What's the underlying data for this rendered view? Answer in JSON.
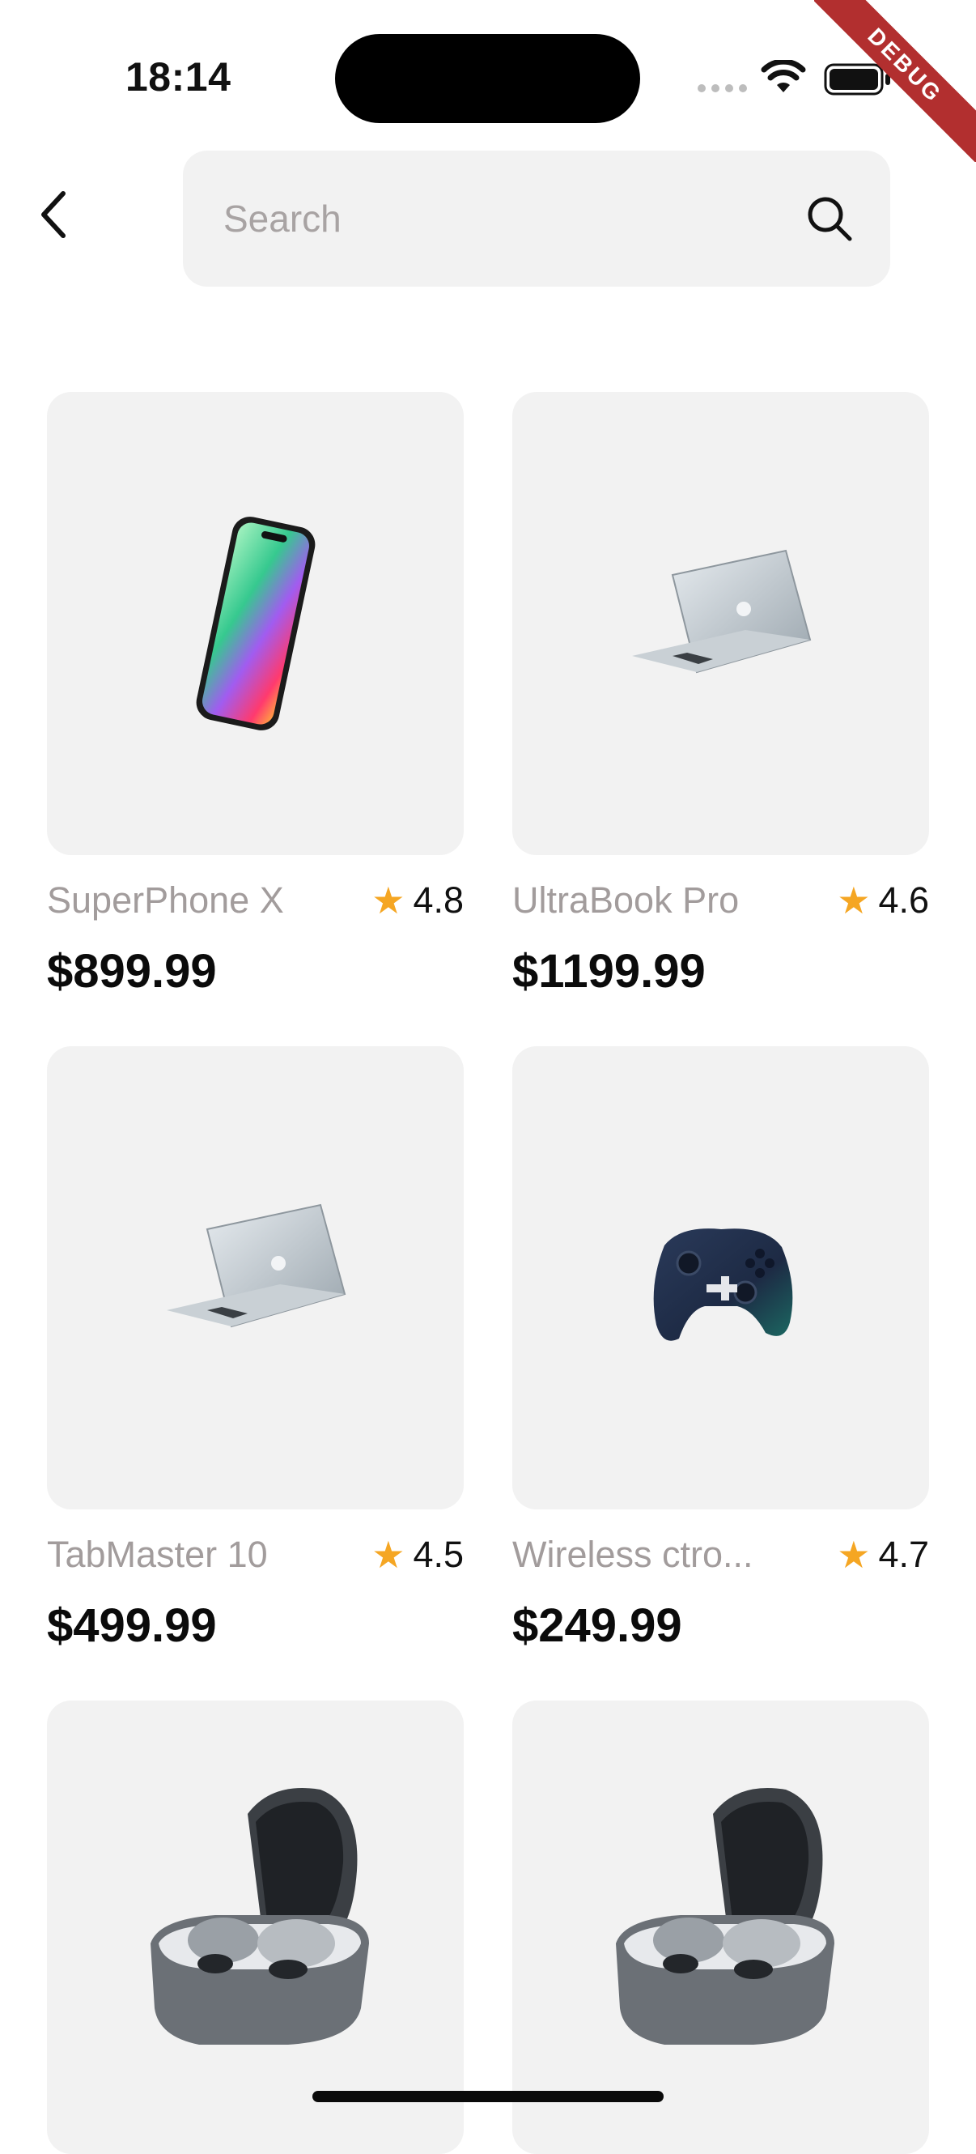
{
  "status": {
    "time": "18:14",
    "debug_label": "DEBUG"
  },
  "search": {
    "placeholder": "Search"
  },
  "products": [
    {
      "name": "SuperPhone X",
      "rating": "4.8",
      "price": "$899.99",
      "image": "phone-image"
    },
    {
      "name": "UltraBook Pro",
      "rating": "4.6",
      "price": "$1199.99",
      "image": "laptop-image"
    },
    {
      "name": "TabMaster 10",
      "rating": "4.5",
      "price": "$499.99",
      "image": "laptop-image"
    },
    {
      "name": "Wireless ctro...",
      "rating": "4.7",
      "price": "$249.99",
      "image": "controller-image"
    },
    {
      "image": "earbuds-image"
    },
    {
      "image": "earbuds-image"
    }
  ],
  "colors": {
    "accent_star": "#f5a623",
    "card_bg": "#f2f2f2",
    "name_text": "#a29c9c"
  },
  "icons": [
    "back-arrow-icon",
    "search-icon",
    "star-icon",
    "wifi-icon",
    "battery-icon",
    "signal-icon"
  ]
}
